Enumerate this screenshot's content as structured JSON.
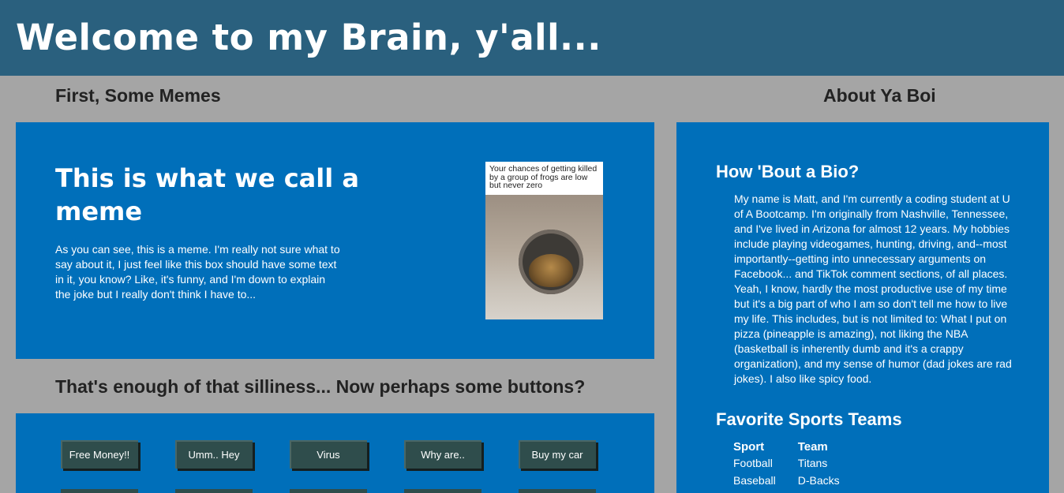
{
  "header": {
    "title": "Welcome to my Brain, y'all..."
  },
  "memes": {
    "heading": "First, Some Memes",
    "card_title": "This is what we call a meme",
    "card_text": "As you can see, this is a meme. I'm really not sure what to say about it, I just feel like this box should have some text in it, you know? Like, it's funny, and I'm down to explain the joke but I really don't think I have to...",
    "image_caption": "Your chances of getting killed by a group of frogs are low but never zero"
  },
  "buttons_section": {
    "heading": "That's enough of that silliness... Now perhaps some buttons?",
    "buttons": [
      "Free Money!!",
      "Umm.. Hey",
      "Virus",
      "Why are..",
      "Buy my car"
    ]
  },
  "about": {
    "heading": "About Ya Boi",
    "bio_heading": "How 'Bout a Bio?",
    "bio_text": "My name is Matt, and I'm currently a coding student at U of A Bootcamp. I'm originally from Nashville, Tennessee, and I've lived in Arizona for almost 12 years. My hobbies include playing videogames, hunting, driving, and--most importantly--getting into unnecessary arguments on Facebook... and TikTok comment sections, of all places. Yeah, I know, hardly the most productive use of my time but it's a big part of who I am so don't tell me how to live my life. This includes, but is not limited to: What I put on pizza (pineapple is amazing), not liking the NBA (basketball is inherently dumb and it's a crappy organization), and my sense of humor (dad jokes are rad jokes). I also like spicy food.",
    "teams_heading": "Favorite Sports Teams",
    "teams_table": {
      "headers": [
        "Sport",
        "Team"
      ],
      "rows": [
        [
          "Football",
          "Titans"
        ],
        [
          "Baseball",
          "D-Backs"
        ]
      ]
    }
  },
  "colors": {
    "header_bg": "#2a607e",
    "page_bg": "#a5a5a5",
    "card_bg": "#006fba",
    "button_bg": "#2f4d4c"
  }
}
